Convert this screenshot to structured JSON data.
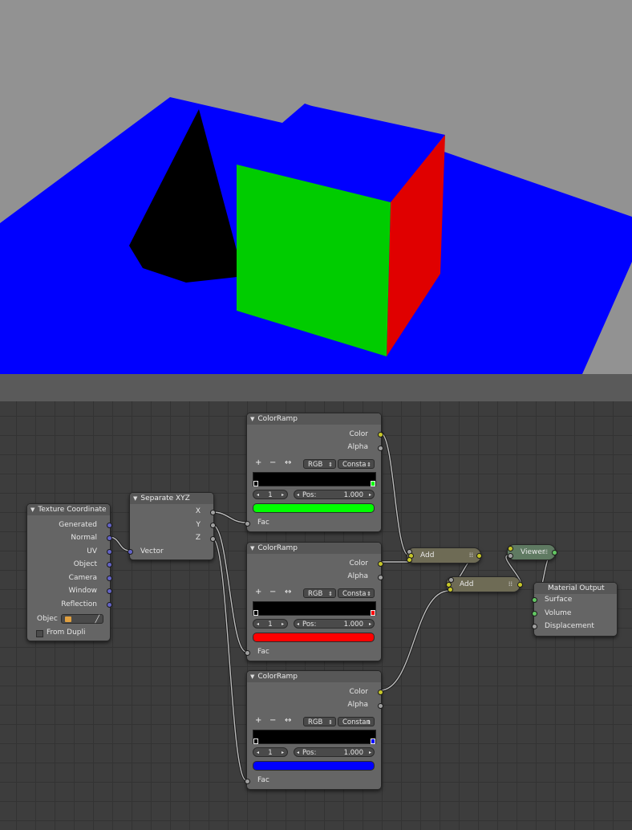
{
  "viewport": {
    "colors": {
      "ground": "#0000ff",
      "cube_front": "#00cc00",
      "cube_side": "#e00000",
      "cube_top": "#0000ff",
      "cone": "#000000",
      "background": "#929292"
    }
  },
  "nodes": {
    "texture_coordinate": {
      "title": "Texture Coordinate",
      "outputs": [
        "Generated",
        "Normal",
        "UV",
        "Object",
        "Camera",
        "Window",
        "Reflection"
      ],
      "object_label": "Objec",
      "from_dupli_label": "From Dupli"
    },
    "separate_xyz": {
      "title": "Separate XYZ",
      "outputs": [
        "X",
        "Y",
        "Z"
      ],
      "input": "Vector"
    },
    "colorramp_1": {
      "title": "ColorRamp",
      "outputs": [
        "Color",
        "Alpha"
      ],
      "mode": "RGB",
      "interp": "Consta",
      "index": "1",
      "pos_label": "Pos:",
      "pos_value": "1.000",
      "stop_color": "#00ff00",
      "input": "Fac"
    },
    "colorramp_2": {
      "title": "ColorRamp",
      "outputs": [
        "Color",
        "Alpha"
      ],
      "mode": "RGB",
      "interp": "Consta",
      "index": "1",
      "pos_label": "Pos:",
      "pos_value": "1.000",
      "stop_color": "#ff0000",
      "input": "Fac"
    },
    "colorramp_3": {
      "title": "ColorRamp",
      "outputs": [
        "Color",
        "Alpha"
      ],
      "mode": "RGB",
      "interp": "Constan",
      "index": "1",
      "pos_label": "Pos:",
      "pos_value": "1.000",
      "stop_color": "#0000ff",
      "input": "Fac"
    },
    "add_1": {
      "title": "Add"
    },
    "add_2": {
      "title": "Add"
    },
    "viewer": {
      "title": "Viewer"
    },
    "material_output": {
      "title": "Material Output",
      "inputs": [
        "Surface",
        "Volume",
        "Displacement"
      ]
    }
  },
  "ramp_tools": {
    "add": "+",
    "remove": "−",
    "flip": "↔"
  }
}
